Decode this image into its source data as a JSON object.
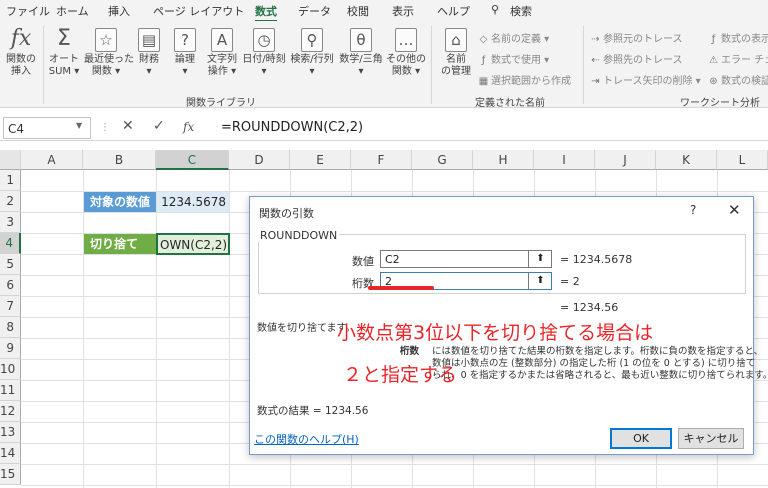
{
  "menu": [
    "ファイル",
    "ホーム",
    "挿入",
    "ページ レイアウト",
    "数式",
    "データ",
    "校閲",
    "表示",
    "ヘルプ",
    "検索"
  ],
  "ribbon": {
    "insert_func": "関数の\n挿入",
    "autosum": "オート\nSUM ▾",
    "recent": "最近使った\n関数 ▾",
    "finance": "財務\n▾",
    "logic": "論理\n▾",
    "text": "文字列\n操作 ▾",
    "datetime": "日付/時刻\n▾",
    "lookup": "検索/行列\n▾",
    "math": "数学/三角\n▾",
    "other": "その他の\n関数 ▾",
    "group1": "関数ライブラリ",
    "name_mgr": "名前\nの管理",
    "define_name": "名前の定義 ▾",
    "use_in_formula": "数式で使用 ▾",
    "create_from_sel": "選択範囲から作成",
    "group2": "定義された名前",
    "trace_prec": "参照元のトレース",
    "trace_dep": "参照先のトレース",
    "remove_arrows": "トレース矢印の削除 ▾",
    "show_formulas": "数式の表示",
    "error_check": "エラー チェック",
    "eval_formula": "数式の検証",
    "group3": "ワークシート分析"
  },
  "formula_bar": {
    "namebox": "C4",
    "formula": "=ROUNDDOWN(C2,2)"
  },
  "columns": [
    "A",
    "B",
    "C",
    "D",
    "E",
    "F",
    "G",
    "H",
    "I",
    "J",
    "K",
    "L"
  ],
  "rows": [
    "1",
    "2",
    "3",
    "4",
    "5",
    "6",
    "7",
    "8",
    "9",
    "10",
    "11",
    "12",
    "13",
    "14",
    "15"
  ],
  "cells": {
    "b2": "対象の数値",
    "c2": "1234.5678",
    "b4": "切り捨て",
    "c4": "OWN(C2,2)"
  },
  "dialog": {
    "title": "関数の引数",
    "help_q": "?",
    "close": "✕",
    "func_name": "ROUNDDOWN",
    "arg1_label": "数値",
    "arg1_value": "C2",
    "arg1_result": "=  1234.5678",
    "arg2_label": "桁数",
    "arg2_value": "2",
    "arg2_result": "=  2",
    "total_result": "=  1234.56",
    "desc": "数値を切り捨てます。",
    "arg_desc_label": "桁数",
    "arg_desc1": "には数値を切り捨てた結果の桁数を指定します。桁数に負の数を指定すると、",
    "arg_desc2": "数値は小数点の左 (整数部分) の指定した桁 (1 の位を 0 とする) に切り捨て",
    "arg_desc3": "られ、0 を指定するかまたは省略されると、最も近い整数に切り捨てられます。",
    "result_line": "数式の結果 =   1234.56",
    "help_link": "この関数のヘルプ(H)",
    "ok": "OK",
    "cancel": "キャンセル"
  },
  "annotation": {
    "line1": "小数点第3位以下を切り捨てる場合は",
    "line2": "２と指定する"
  },
  "colors": {
    "accent": "#217346",
    "label_blue": "#5b9bd5",
    "label_green": "#70ad47",
    "annotation_red": "#e8262a"
  }
}
